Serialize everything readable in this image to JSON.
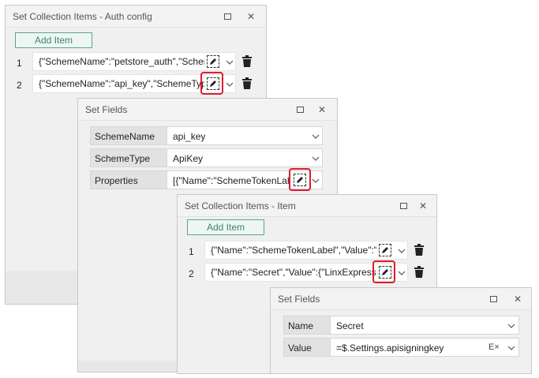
{
  "window1": {
    "title": "Set Collection Items - Auth config",
    "add_item_label": "Add Item",
    "rows": [
      {
        "index": "1",
        "value": "{\"SchemeName\":\"petstore_auth\",\"Scheme"
      },
      {
        "index": "2",
        "value": "{\"SchemeName\":\"api_key\",\"SchemeType\""
      }
    ]
  },
  "window2": {
    "title": "Set Fields",
    "fields": [
      {
        "label": "SchemeName",
        "value": "api_key"
      },
      {
        "label": "SchemeType",
        "value": "ApiKey"
      },
      {
        "label": "Properties",
        "value": "[{\"Name\":\"SchemeTokenLabe"
      }
    ]
  },
  "window3": {
    "title": "Set Collection Items - Item",
    "add_item_label": "Add Item",
    "rows": [
      {
        "index": "1",
        "value": "{\"Name\":\"SchemeTokenLabel\",\"Value\":\"Be"
      },
      {
        "index": "2",
        "value": "{\"Name\":\"Secret\",\"Value\":{\"LinxExpression"
      }
    ]
  },
  "window4": {
    "title": "Set Fields",
    "fields": [
      {
        "label": "Name",
        "value": "Secret"
      },
      {
        "label": "Value",
        "value": "=$.Settings.apisigningkey",
        "clear_symbol": "E×"
      }
    ]
  },
  "colors": {
    "accent_green": "#3b8568",
    "highlight_red": "#e01b2e"
  }
}
